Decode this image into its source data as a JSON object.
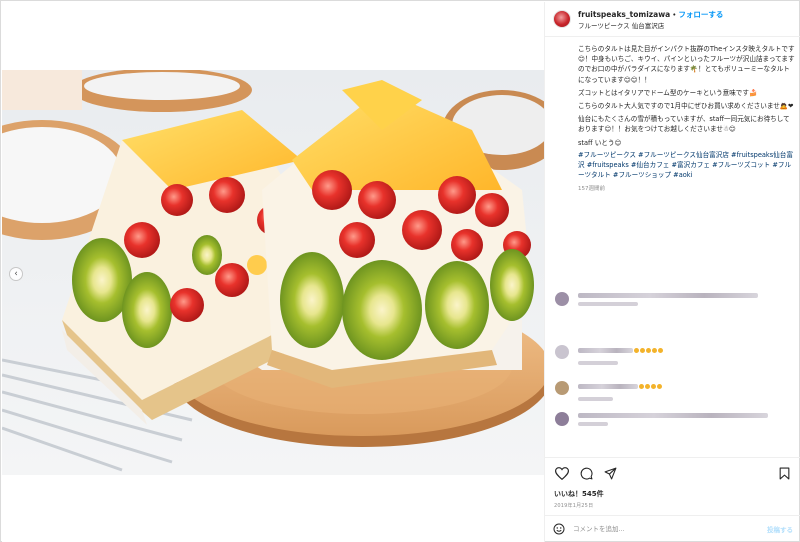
{
  "header": {
    "username": "fruitspeaks_tomizawa",
    "separator": "•",
    "follow_label": "フォローする",
    "location": "フルーツピークス 仙台富沢店"
  },
  "caption": {
    "lines": [
      "こちらのタルトは見た目がインパクト抜群のTheインスタ映えタルトです😊！中身もいちご、キウイ、パインといったフルーツが沢山詰まってますのでお口の中がパラダイスになります🌴！とてもボリューミーなタルトになっています😊😊！！",
      "ズコットとはイタリアでドーム型のケーキという意味です🍰",
      "こちらのタルト大人気ですので1月中にぜひお買い求めくださいませ🙇❤",
      "仙台にもたくさんの雪が積もっていますが、staff一同元気にお待ちしております😊！！お気をつけてお越しくださいませ☃😊"
    ],
    "staff": "staff いとう😊",
    "hashtags": "#フルーツピークス #フルーツピークス仙台富沢店 #fruitspeaks仙台富沢 #fruitspeaks #仙台カフェ #富沢カフェ #フルーツズコット #フルーツタルト #フルーツショップ #aoki",
    "time_ago": "157週間前"
  },
  "actions": {
    "like_icon": "heart-icon",
    "comment_icon": "comment-icon",
    "share_icon": "share-icon",
    "save_icon": "bookmark-icon"
  },
  "likes_text": "いいね！545件",
  "date_text": "2019年1月25日",
  "comment_box": {
    "placeholder": "コメントを追加...",
    "post_label": "投稿する"
  },
  "colors": {
    "follow_blue": "#0095f6",
    "hashtag_blue": "#00376b",
    "post_disabled": "#b2dffc",
    "brand_red": "#c8242a"
  }
}
